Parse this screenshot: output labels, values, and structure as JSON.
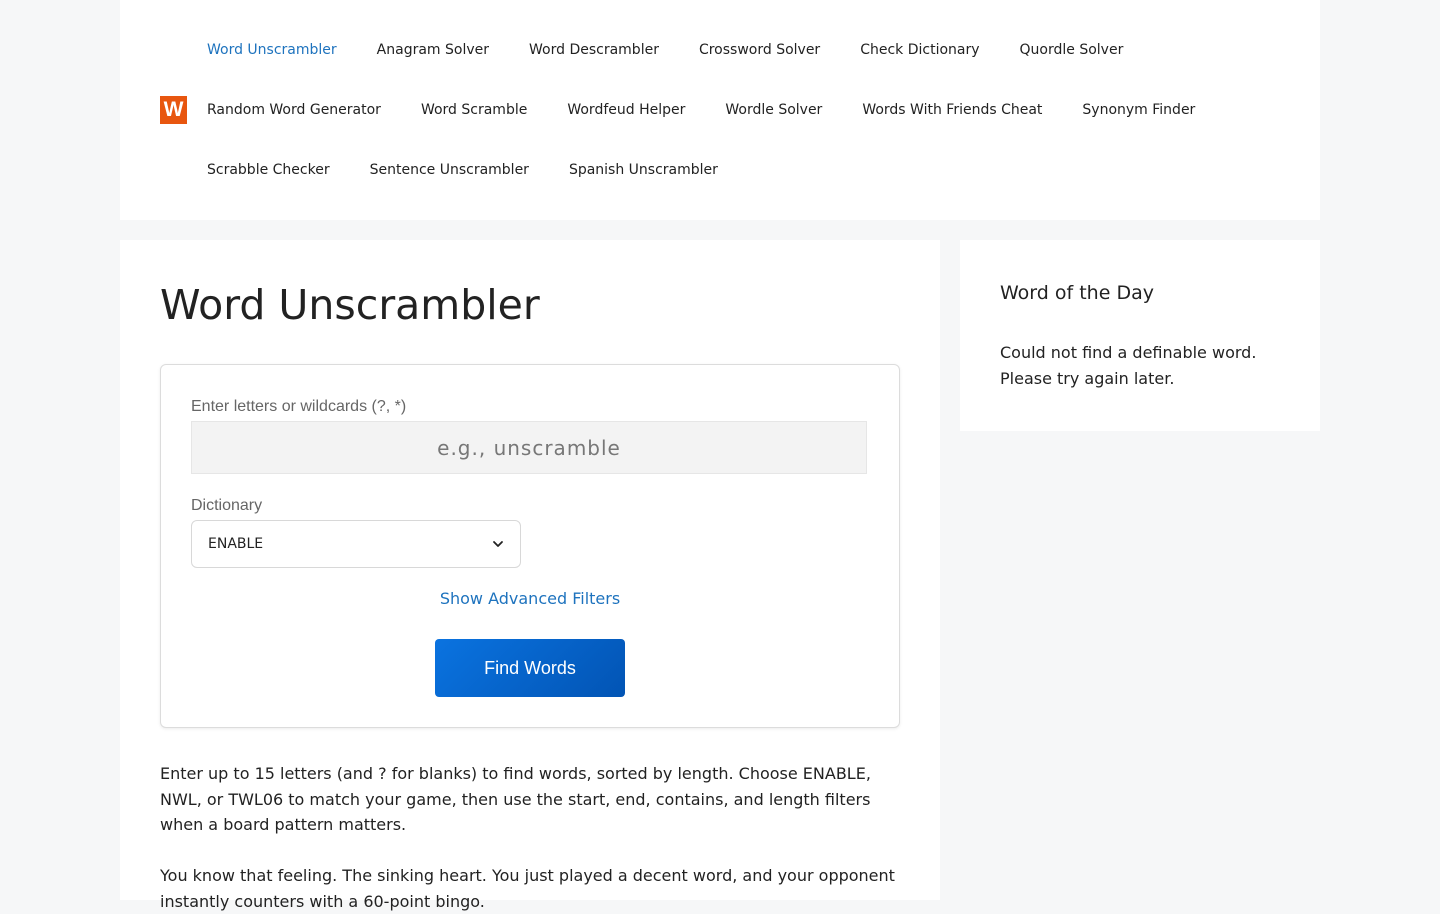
{
  "header": {
    "logo_letter": "W",
    "nav_rows": [
      [
        {
          "label": "Word Unscrambler",
          "active": true
        },
        {
          "label": "Anagram Solver"
        },
        {
          "label": "Word Descrambler"
        },
        {
          "label": "Crossword Solver"
        },
        {
          "label": "Check Dictionary"
        },
        {
          "label": "Quordle Solver"
        }
      ],
      [
        {
          "label": "Random Word Generator"
        },
        {
          "label": "Word Scramble"
        },
        {
          "label": "Wordfeud Helper"
        },
        {
          "label": "Wordle Solver"
        },
        {
          "label": "Words With Friends Cheat"
        },
        {
          "label": "Synonym Finder"
        }
      ],
      [
        {
          "label": "Scrabble Checker"
        },
        {
          "label": "Sentence Unscrambler"
        },
        {
          "label": "Spanish Unscrambler"
        }
      ]
    ]
  },
  "main": {
    "title": "Word Unscrambler",
    "form": {
      "letters_label": "Enter letters or wildcards (?, *)",
      "letters_placeholder": "e.g., unscramble",
      "letters_value": "",
      "dictionary_label": "Dictionary",
      "dictionary_selected": "ENABLE",
      "advanced_link": "Show Advanced Filters",
      "submit_label": "Find Words"
    },
    "paragraphs": [
      "Enter up to 15 letters (and ? for blanks) to find words, sorted by length. Choose ENABLE, NWL, or TWL06 to match your game, then use the start, end, contains, and length filters when a board pattern matters.",
      "You know that feeling. The sinking heart. You just played a decent word, and your opponent instantly counters with a 60-point bingo."
    ]
  },
  "sidebar": {
    "widget_title": "Word of the Day",
    "widget_text": "Could not find a definable word. Please try again later."
  },
  "colors": {
    "accent": "#1e73be",
    "logo": "#e8560f",
    "button": "#0663cc",
    "page_bg": "#f6f7f8"
  },
  "icons": {
    "select_arrow": "chevron-down-icon"
  }
}
